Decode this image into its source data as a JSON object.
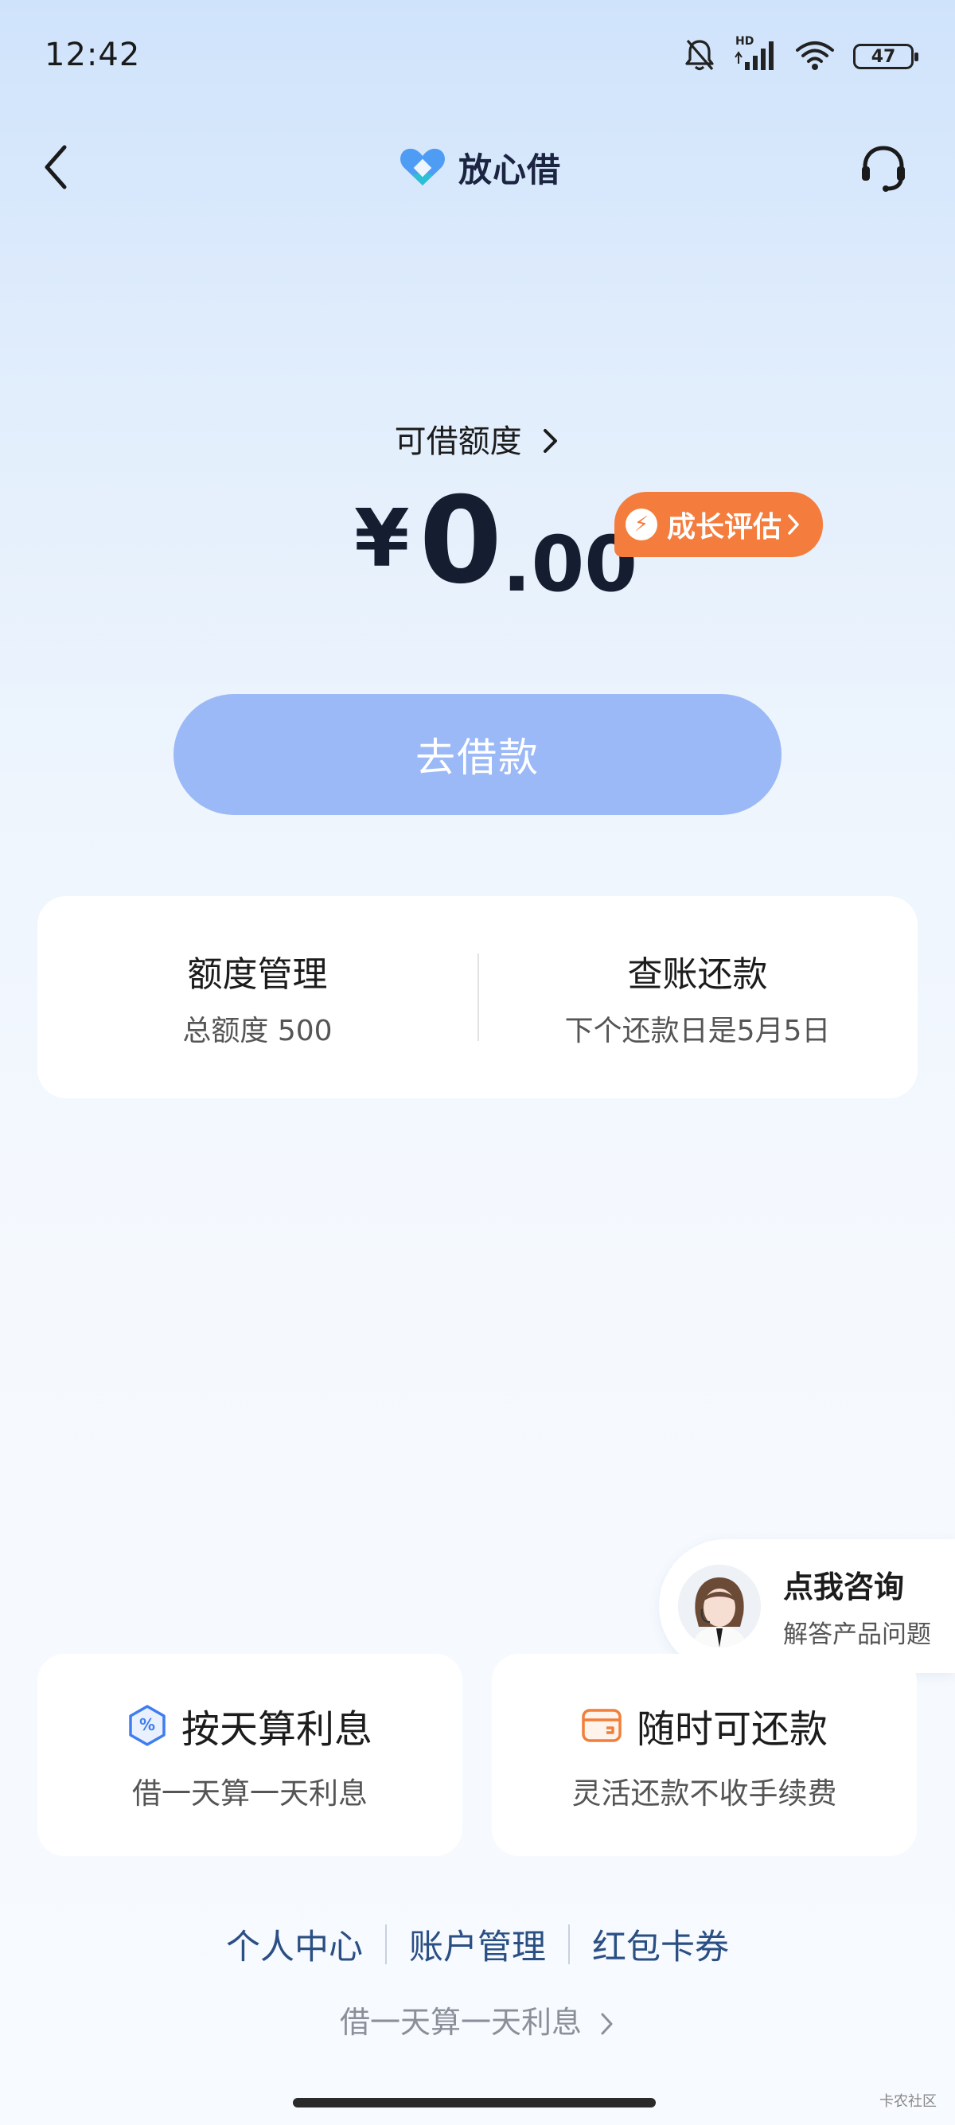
{
  "status_bar": {
    "time": "12:42",
    "network_label": "HD",
    "battery": "47",
    "icons": [
      "bell-muted-icon",
      "signal-icon",
      "wifi-icon",
      "battery-icon"
    ]
  },
  "nav": {
    "brand_name": "放心借",
    "icons": [
      "back-chevron-icon",
      "heart-logo-icon",
      "headset-icon"
    ]
  },
  "credit": {
    "label": "可借额度",
    "currency": "¥",
    "amount_int": "0",
    "amount_dec": ".00",
    "growth_badge": "成长评估"
  },
  "borrow_button": "去借款",
  "manage_card": {
    "limit_title": "额度管理",
    "limit_sub": "总额度 500",
    "repay_title": "查账还款",
    "repay_sub": "下个还款日是5月5日"
  },
  "consult": {
    "title": "点我咨询",
    "subtitle": "解答产品问题"
  },
  "features": [
    {
      "title": "按天算利息",
      "subtitle": "借一天算一天利息",
      "icon": "percent-hexagon-icon"
    },
    {
      "title": "随时可还款",
      "subtitle": "灵活还款不收手续费",
      "icon": "wallet-icon"
    }
  ],
  "bottom_links": [
    "个人中心",
    "账户管理",
    "红包卡券"
  ],
  "footer_note": "借一天算一天利息",
  "watermark": "卡农社区",
  "colors": {
    "accent_orange": "#f47c3c",
    "borrow_button": "#9bb9f6",
    "link_blue": "#2a4f84"
  }
}
